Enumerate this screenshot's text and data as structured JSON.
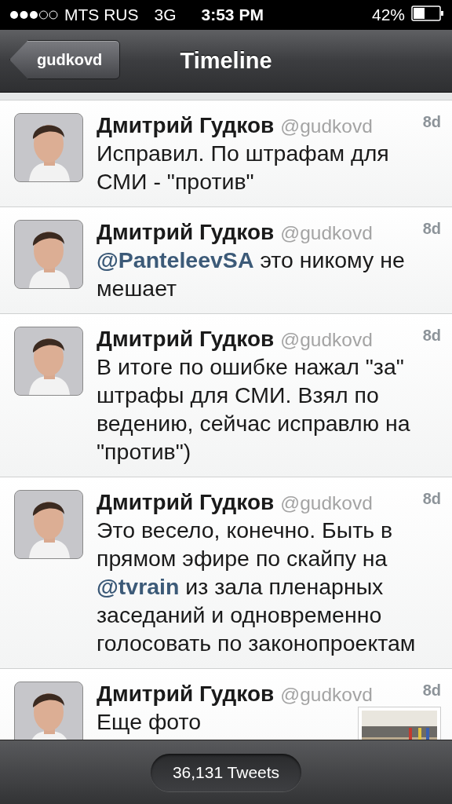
{
  "status_bar": {
    "carrier": "MTS RUS",
    "network": "3G",
    "time": "3:53 PM",
    "battery": "42%"
  },
  "nav_bar": {
    "back_button": "gudkovd",
    "title": "Timeline"
  },
  "tweets": [
    {
      "kind": "text",
      "name": "Дмитрий Гудков",
      "handle": "@gudkovd",
      "age": "8d",
      "text": "Исправил. По штрафам для СМИ - \"против\""
    },
    {
      "kind": "text",
      "name": "Дмитрий Гудков",
      "handle": "@gudkovd",
      "age": "8d",
      "text": "**@PanteleevSA** это никому не мешает"
    },
    {
      "kind": "text",
      "name": "Дмитрий Гудков",
      "handle": "@gudkovd",
      "age": "8d",
      "text": "В итоге по ошибке нажал \"за\" штрафы для СМИ. Взял по ведению, сейчас исправлю на \"против\")"
    },
    {
      "kind": "text",
      "name": "Дмитрий Гудков",
      "handle": "@gudkovd",
      "age": "8d",
      "text": "Это весело, конечно. Быть в прямом эфире по скайпу на **@tvrain** из зала пленарных заседаний и одновременно голосовать по законопроектам"
    },
    {
      "name": "Дмитрий Гудков",
      "handle": "@gudkovd",
      "age": "8d",
      "text": "Еще фото"
    }
  ],
  "footer": {
    "count": "36,131 Tweets"
  }
}
